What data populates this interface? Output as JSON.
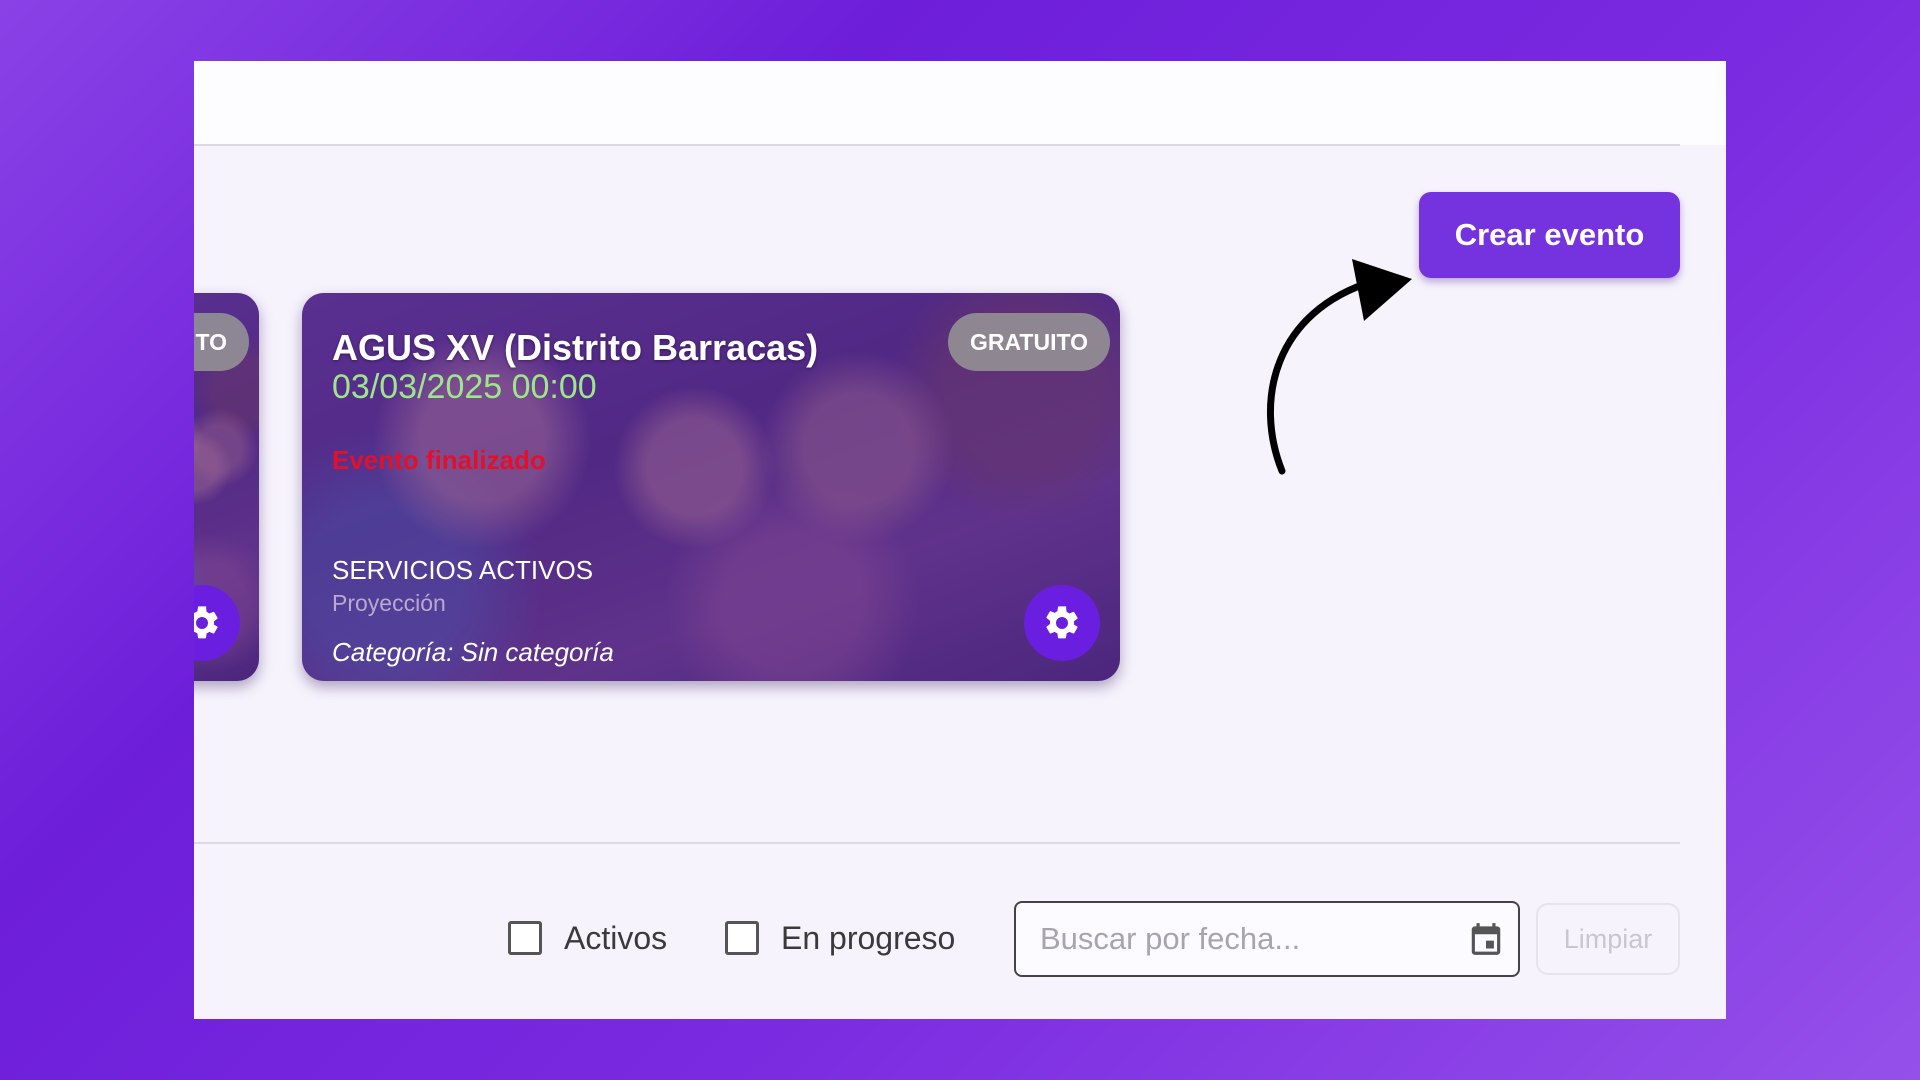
{
  "header": {
    "create_button_label": "Crear evento"
  },
  "events": {
    "partial_card": {
      "badge": "ITO"
    },
    "main_card": {
      "badge": "GRATUITO",
      "title": "AGUS XV (Distrito Barracas)",
      "date": "03/03/2025 00:00",
      "status": "Evento finalizado",
      "services_title": "SERVICIOS ACTIVOS",
      "service": "Proyección",
      "category": "Categoría: Sin categoría"
    }
  },
  "filters": {
    "active_label": "Activos",
    "in_progress_label": "En progreso",
    "date_search_placeholder": "Buscar por fecha...",
    "clear_label": "Limpiar"
  },
  "colors": {
    "accent": "#7433de",
    "date_text": "#9ee68b",
    "status_ended": "#e2102a",
    "gear_button": "#6a1fe0"
  },
  "icons": {
    "gear": "gear-icon",
    "calendar": "calendar-icon",
    "arrow": "curved-arrow-icon"
  }
}
